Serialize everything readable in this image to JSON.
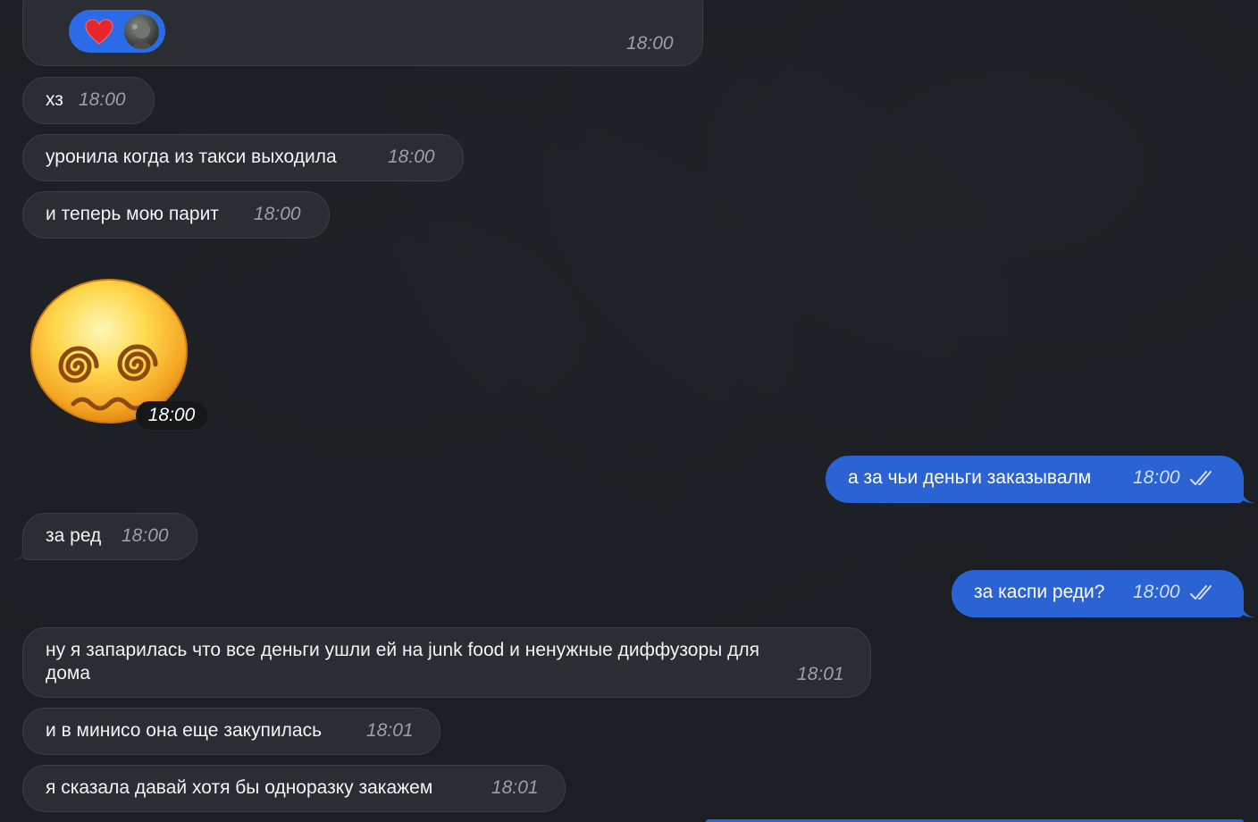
{
  "chat": {
    "top_message": {
      "time": "18:00",
      "reaction": {
        "emoji_icon": "heart-icon",
        "avatar_icon": "user-avatar-icon"
      }
    },
    "messages": [
      {
        "text": "хз",
        "time": "18:00",
        "dir": "in"
      },
      {
        "text": "уронила когда из такси выходила",
        "time": "18:00",
        "dir": "in"
      },
      {
        "text": "и теперь мою парит",
        "time": "18:00",
        "dir": "in"
      },
      {
        "text": "",
        "time": "18:00",
        "dir": "in",
        "sticker": "dizzy-face-emoji"
      },
      {
        "text": "а за чьи деньги заказывалм",
        "time": "18:00",
        "dir": "out",
        "status": "read"
      },
      {
        "text": "за ред",
        "time": "18:00",
        "dir": "in"
      },
      {
        "text": "за каспи реди?",
        "time": "18:00",
        "dir": "out",
        "status": "read"
      },
      {
        "text": "ну я запарилась что все деньги ушли ей на junk food и ненужные диффузоры для",
        "text2": "дома",
        "time": "18:01",
        "dir": "in"
      },
      {
        "text": "и в минисо она еще закупилась",
        "time": "18:01",
        "dir": "in"
      },
      {
        "text": "я сказала давай хотя бы одноразку закажем",
        "time": "18:01",
        "dir": "in"
      }
    ]
  },
  "colors": {
    "background": "#1b1e22",
    "incoming_bubble": "#2a2d32",
    "outgoing_bubble": "#2b63d4",
    "reaction_pill": "#2b6be8"
  }
}
